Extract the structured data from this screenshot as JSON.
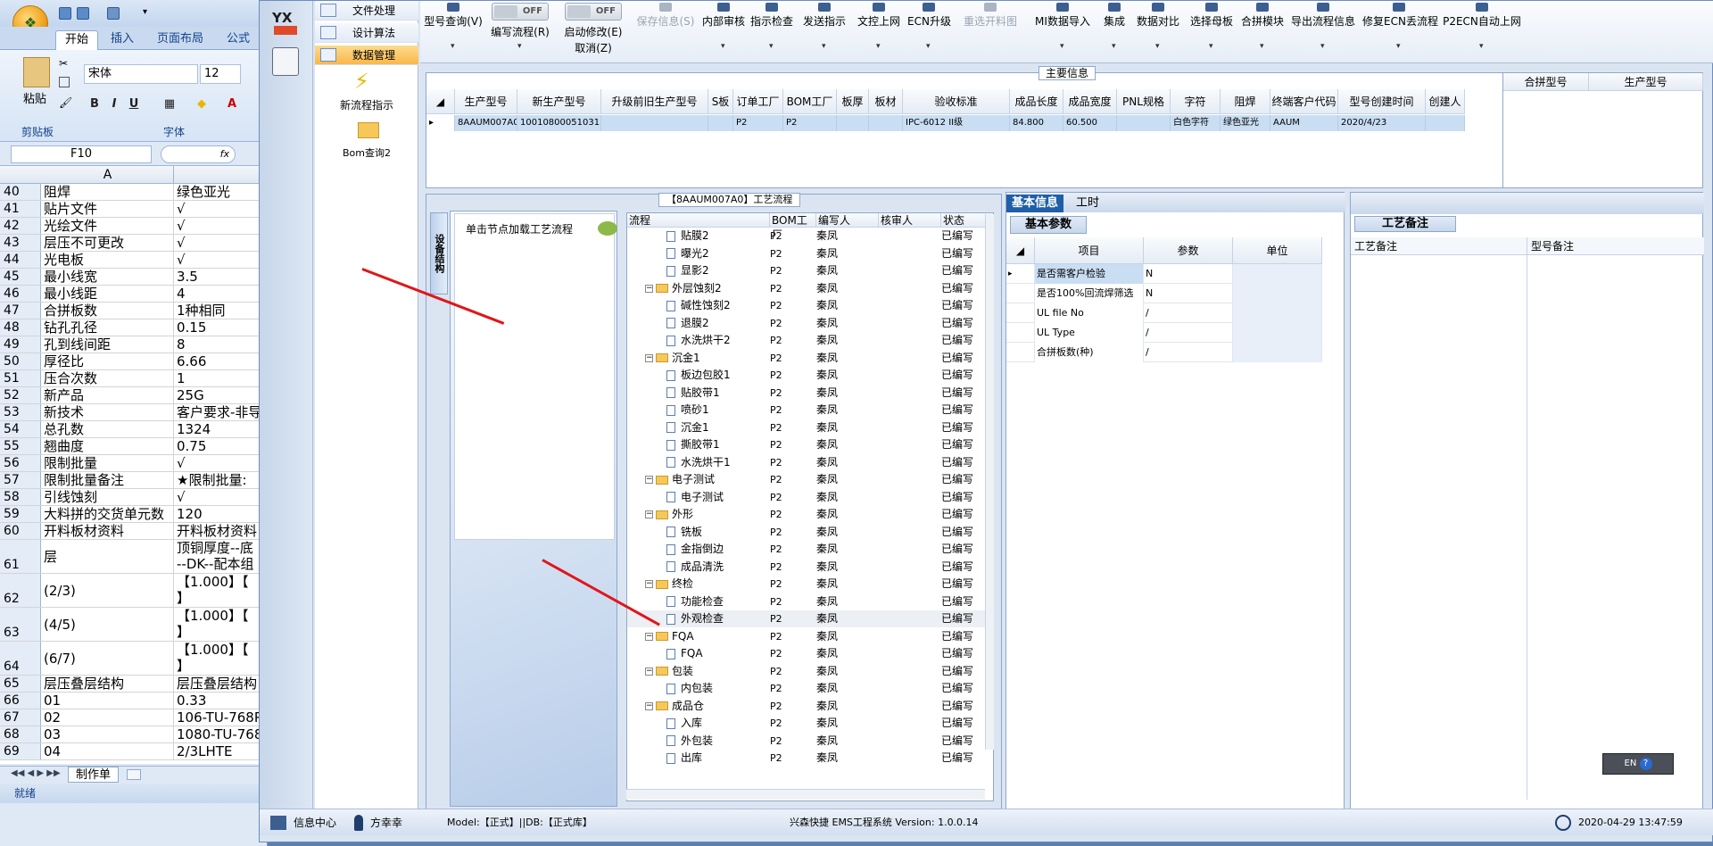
{
  "excel": {
    "tabs": [
      "开始",
      "插入",
      "页面布局",
      "公式"
    ],
    "paste_label": "粘贴",
    "font_name": "宋体",
    "font_size": "12",
    "group_clipboard": "剪贴板",
    "group_font": "字体",
    "name_box": "F10",
    "col_a": "A",
    "rows": [
      {
        "n": "40",
        "a": "阻焊",
        "b": "绿色亚光"
      },
      {
        "n": "41",
        "a": "贴片文件",
        "b": "√"
      },
      {
        "n": "42",
        "a": "光绘文件",
        "b": "√"
      },
      {
        "n": "43",
        "a": "层压不可更改",
        "b": "√"
      },
      {
        "n": "44",
        "a": "光电板",
        "b": "√"
      },
      {
        "n": "45",
        "a": "最小线宽",
        "b": "3.5"
      },
      {
        "n": "46",
        "a": "最小线距",
        "b": "4"
      },
      {
        "n": "47",
        "a": "合拼板数",
        "b": "1种相同"
      },
      {
        "n": "48",
        "a": "钻孔孔径",
        "b": "0.15"
      },
      {
        "n": "49",
        "a": "孔到线间距",
        "b": "8"
      },
      {
        "n": "50",
        "a": "厚径比",
        "b": "6.66"
      },
      {
        "n": "51",
        "a": "压合次数",
        "b": "1"
      },
      {
        "n": "52",
        "a": "新产品",
        "b": "25G"
      },
      {
        "n": "53",
        "a": "新技术",
        "b": "客户要求-非导"
      },
      {
        "n": "54",
        "a": "总孔数",
        "b": "1324"
      },
      {
        "n": "55",
        "a": "翘曲度",
        "b": "0.75"
      },
      {
        "n": "56",
        "a": "限制批量",
        "b": "√"
      },
      {
        "n": "57",
        "a": "限制批量备注",
        "b": "★限制批量:"
      },
      {
        "n": "58",
        "a": "引线蚀刻",
        "b": "√"
      },
      {
        "n": "59",
        "a": "大料拼的交货单元数",
        "b": "120"
      },
      {
        "n": "60",
        "a": "开料板材资料",
        "b": "开料板材资料"
      }
    ],
    "tall_rows": [
      {
        "n": "61",
        "a": "层",
        "b1": "顶铜厚度--底",
        "b2": "--DK--配本组"
      },
      {
        "n": "62",
        "a": "(2/3)",
        "b1": "【1.000】【",
        "b2": "】【■■■■■"
      },
      {
        "n": "63",
        "a": "(4/5)",
        "b1": "【1.000】【",
        "b2": "】【■■■■■"
      },
      {
        "n": "64",
        "a": "(6/7)",
        "b1": "【1.000】【",
        "b2": "】【■■■■■"
      }
    ],
    "rows2": [
      {
        "n": "65",
        "a": "层压叠层结构",
        "b": "层压叠层结构"
      },
      {
        "n": "66",
        "a": "01",
        "b": "0.33"
      },
      {
        "n": "67",
        "a": "02",
        "b": "106-TU-768PP"
      },
      {
        "n": "68",
        "a": "03",
        "b": "1080-TU-768P"
      },
      {
        "n": "69",
        "a": "04",
        "b": "2/3LHTE"
      }
    ],
    "sheet_tab": "制作单",
    "status": "就绪"
  },
  "app": {
    "logo": "YX",
    "nav_items": [
      "文件处理",
      "设计算法",
      "数据管理"
    ],
    "nav_tools": [
      "新流程指示",
      "Bom查询2"
    ],
    "toolbar": [
      {
        "label": "型号查询(V)",
        "disabled": false
      },
      {
        "label": "编写流程(R)",
        "disabled": false,
        "toggle": "OFF"
      },
      {
        "label": "启动修改(E)",
        "disabled": false,
        "toggle": "OFF",
        "sub": "取消(Z)"
      },
      {
        "label": "保存信息(S)",
        "disabled": true
      },
      {
        "label": "内部审核",
        "disabled": false
      },
      {
        "label": "指示检查",
        "disabled": false
      },
      {
        "label": "发送指示",
        "disabled": false
      },
      {
        "label": "文控上网",
        "disabled": false
      },
      {
        "label": "ECN升级",
        "disabled": false
      },
      {
        "label": "重选开料图",
        "disabled": true
      },
      {
        "label": "MI数据导入",
        "disabled": false
      },
      {
        "label": "集成",
        "disabled": false
      },
      {
        "label": "数据对比",
        "disabled": false
      },
      {
        "label": "选择母板",
        "disabled": false
      },
      {
        "label": "合拼模块",
        "disabled": false
      },
      {
        "label": "导出流程信息",
        "disabled": false
      },
      {
        "label": "修复ECN丢流程",
        "disabled": false
      },
      {
        "label": "P2ECN自动上网",
        "disabled": false
      }
    ],
    "main_info": {
      "title": "主要信息",
      "headers": [
        "生产型号",
        "新生产型号",
        "升级前旧生产型号",
        "S板",
        "订单工厂",
        "BOM工厂",
        "板厚",
        "板材",
        "验收标准",
        "成品长度",
        "成品宽度",
        "PNL规格",
        "字符",
        "阻焊",
        "终端客户代码",
        "型号创建时间",
        "创建人"
      ],
      "row": [
        "8AAUM007A0",
        "10010800051031",
        "",
        "",
        "P2",
        "P2",
        "",
        "",
        "IPC-6012 II级",
        "84.800",
        "60.500",
        "",
        "白色字符",
        "绿色亚光",
        "AAUM",
        "2020/4/23",
        ""
      ],
      "side_headers": [
        "合拼型号",
        "生产型号"
      ]
    },
    "process": {
      "title": "【8AAUM007A0】工艺流程",
      "vtab": "设备结构",
      "hint": "单击节点加载工艺流程",
      "columns": [
        "流程",
        "BOM工厂",
        "编写人",
        "核审人",
        "状态"
      ],
      "rows": [
        {
          "name": "贴膜2",
          "lvl": 2,
          "kind": "doc",
          "f": "P2",
          "w": "秦凤",
          "s": "已编写"
        },
        {
          "name": "曝光2",
          "lvl": 2,
          "kind": "doc",
          "f": "P2",
          "w": "秦凤",
          "s": "已编写"
        },
        {
          "name": "显影2",
          "lvl": 2,
          "kind": "doc",
          "f": "P2",
          "w": "秦凤",
          "s": "已编写"
        },
        {
          "name": "外层蚀刻2",
          "lvl": 1,
          "kind": "folder",
          "f": "P2",
          "w": "秦凤",
          "s": "已编写"
        },
        {
          "name": "碱性蚀刻2",
          "lvl": 2,
          "kind": "doc",
          "f": "P2",
          "w": "秦凤",
          "s": "已编写"
        },
        {
          "name": "退膜2",
          "lvl": 2,
          "kind": "doc",
          "f": "P2",
          "w": "秦凤",
          "s": "已编写"
        },
        {
          "name": "水洗烘干2",
          "lvl": 2,
          "kind": "doc",
          "f": "P2",
          "w": "秦凤",
          "s": "已编写"
        },
        {
          "name": "沉金1",
          "lvl": 1,
          "kind": "folder",
          "f": "P2",
          "w": "秦凤",
          "s": "已编写"
        },
        {
          "name": "板边包胶1",
          "lvl": 2,
          "kind": "doc",
          "f": "P2",
          "w": "秦凤",
          "s": "已编写"
        },
        {
          "name": "贴胶带1",
          "lvl": 2,
          "kind": "doc",
          "f": "P2",
          "w": "秦凤",
          "s": "已编写"
        },
        {
          "name": "喷砂1",
          "lvl": 2,
          "kind": "doc",
          "f": "P2",
          "w": "秦凤",
          "s": "已编写"
        },
        {
          "name": "沉金1",
          "lvl": 2,
          "kind": "doc",
          "f": "P2",
          "w": "秦凤",
          "s": "已编写"
        },
        {
          "name": "撕胶带1",
          "lvl": 2,
          "kind": "doc",
          "f": "P2",
          "w": "秦凤",
          "s": "已编写"
        },
        {
          "name": "水洗烘干1",
          "lvl": 2,
          "kind": "doc",
          "f": "P2",
          "w": "秦凤",
          "s": "已编写"
        },
        {
          "name": "电子测试",
          "lvl": 1,
          "kind": "folder",
          "f": "P2",
          "w": "秦凤",
          "s": "已编写"
        },
        {
          "name": "电子测试",
          "lvl": 2,
          "kind": "doc",
          "f": "P2",
          "w": "秦凤",
          "s": "已编写"
        },
        {
          "name": "外形",
          "lvl": 1,
          "kind": "folder",
          "f": "P2",
          "w": "秦凤",
          "s": "已编写"
        },
        {
          "name": "铣板",
          "lvl": 2,
          "kind": "doc",
          "f": "P2",
          "w": "秦凤",
          "s": "已编写"
        },
        {
          "name": "金指倒边",
          "lvl": 2,
          "kind": "doc",
          "f": "P2",
          "w": "秦凤",
          "s": "已编写"
        },
        {
          "name": "成品清洗",
          "lvl": 2,
          "kind": "doc",
          "f": "P2",
          "w": "秦凤",
          "s": "已编写"
        },
        {
          "name": "终检",
          "lvl": 1,
          "kind": "folder",
          "f": "P2",
          "w": "秦凤",
          "s": "已编写"
        },
        {
          "name": "功能检查",
          "lvl": 2,
          "kind": "doc",
          "f": "P2",
          "w": "秦凤",
          "s": "已编写"
        },
        {
          "name": "外观检查",
          "lvl": 2,
          "kind": "doc",
          "f": "P2",
          "w": "秦凤",
          "s": "已编写",
          "sel": true
        },
        {
          "name": "FQA",
          "lvl": 1,
          "kind": "folder",
          "f": "P2",
          "w": "秦凤",
          "s": "已编写"
        },
        {
          "name": "FQA",
          "lvl": 2,
          "kind": "doc",
          "f": "P2",
          "w": "秦凤",
          "s": "已编写"
        },
        {
          "name": "包装",
          "lvl": 1,
          "kind": "folder",
          "f": "P2",
          "w": "秦凤",
          "s": "已编写"
        },
        {
          "name": "内包装",
          "lvl": 2,
          "kind": "doc",
          "f": "P2",
          "w": "秦凤",
          "s": "已编写"
        },
        {
          "name": "成品仓",
          "lvl": 1,
          "kind": "folder",
          "f": "P2",
          "w": "秦凤",
          "s": "已编写"
        },
        {
          "name": "入库",
          "lvl": 2,
          "kind": "doc",
          "f": "P2",
          "w": "秦凤",
          "s": "已编写"
        },
        {
          "name": "外包装",
          "lvl": 2,
          "kind": "doc",
          "f": "P2",
          "w": "秦凤",
          "s": "已编写"
        },
        {
          "name": "出库",
          "lvl": 2,
          "kind": "doc",
          "f": "P2",
          "w": "秦凤",
          "s": "已编写"
        }
      ]
    },
    "basic": {
      "tabs": [
        "基本信息",
        "工时"
      ],
      "title": "基本参数",
      "headers": [
        "项目",
        "参数",
        "单位"
      ],
      "rows": [
        {
          "k": "是否需客户检验",
          "v": "N"
        },
        {
          "k": "是否100%回流焊筛选",
          "v": "N"
        },
        {
          "k": "UL file No",
          "v": "/"
        },
        {
          "k": "UL Type",
          "v": "/"
        },
        {
          "k": "合拼板数(种)",
          "v": "/"
        }
      ]
    },
    "craft": {
      "title": "工艺备注",
      "col1": "工艺备注",
      "col2": "型号备注"
    },
    "lang": "EN",
    "status": {
      "msg_center": "信息中心",
      "user": "方幸幸",
      "model": "Model:【正式】||DB:【正式库】",
      "version": "兴森快捷 EMS工程系统 Version: 1.0.0.14",
      "datetime": "2020-04-29 13:47:59"
    }
  }
}
